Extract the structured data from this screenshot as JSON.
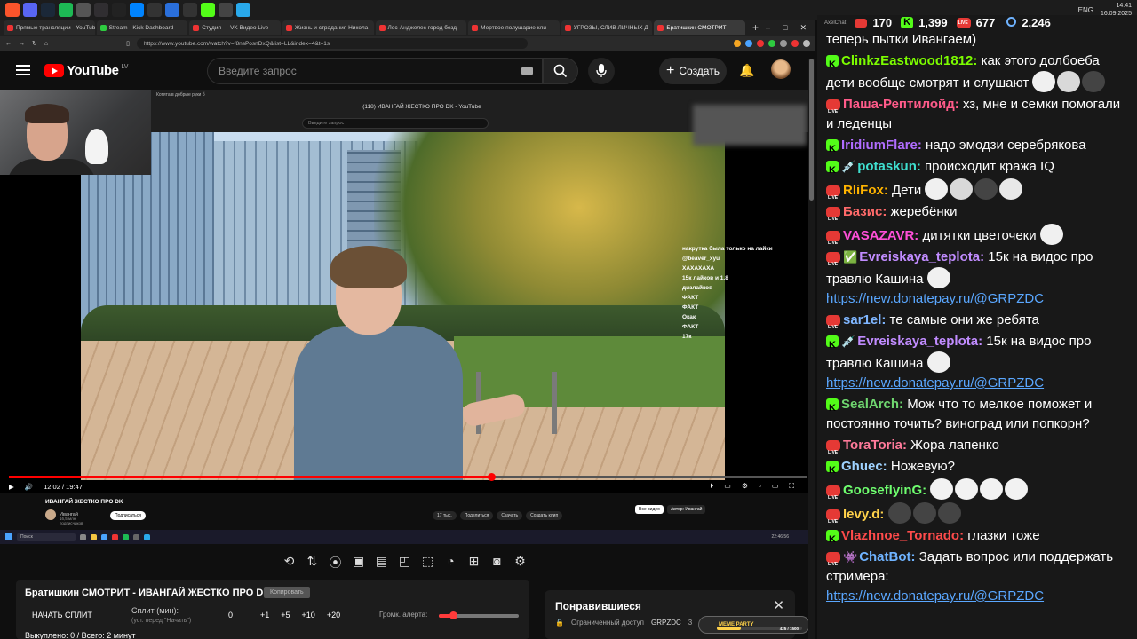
{
  "taskbar": {
    "clock_time": "14:41",
    "clock_date": "16.09.2025",
    "lang": "ENG",
    "icons": [
      {
        "name": "brave-icon",
        "color": "#fb542b"
      },
      {
        "name": "discord-icon",
        "color": "#5865f2"
      },
      {
        "name": "steam-icon",
        "color": "#1b2838"
      },
      {
        "name": "spotify-icon",
        "color": "#1db954"
      },
      {
        "name": "app-icon",
        "color": "#555555"
      },
      {
        "name": "obs-icon",
        "color": "#302e31"
      },
      {
        "name": "capcut-icon",
        "color": "#222222"
      },
      {
        "name": "messenger-icon",
        "color": "#0084ff"
      },
      {
        "name": "app2-icon",
        "color": "#333333"
      },
      {
        "name": "app3-icon",
        "color": "#2a6fdb"
      },
      {
        "name": "app4-icon",
        "color": "#333333"
      },
      {
        "name": "kick-icon",
        "color": "#53fc18"
      },
      {
        "name": "app5-icon",
        "color": "#444444"
      },
      {
        "name": "telegram-icon",
        "color": "#29a9eb"
      }
    ]
  },
  "browser": {
    "tabs": [
      {
        "label": "Прямые трансляции - YouTub",
        "fav": "red"
      },
      {
        "label": "Stream - Kick Dashboard",
        "fav": "green"
      },
      {
        "label": "Студия — VK Видео Live",
        "fav": "red"
      },
      {
        "label": "Жизнь и страдания Никола",
        "fav": "red"
      },
      {
        "label": "Лос-Анджелес город безд",
        "fav": "red"
      },
      {
        "label": "Мертвое полушарие кли",
        "fav": "red"
      },
      {
        "label": "УГРОЗЫ, СЛИВ ЛИЧНЫХ Д",
        "fav": "red"
      },
      {
        "label": "Братишкин СМОТРИТ -",
        "fav": "red",
        "active": true
      }
    ],
    "new_tab": "+",
    "url": "https://www.youtube.com/watch?v=f8nsPosnDxQ&list=LL&index=4&t=1s"
  },
  "youtube": {
    "logo_text": "YouTube",
    "logo_region": "LV",
    "search_placeholder": "Введите запрос",
    "create_label": "Создать"
  },
  "video": {
    "inner_window_title": "(118) ИВАНГАЙ ЖЕСТКО ПРО DK - YouTube",
    "inner_tab_label": "Котята в добрые руки б",
    "inner_search_placeholder": "Введите запрос",
    "time_current": "12:02",
    "time_total": "19:47",
    "progress_fraction": 0.605,
    "stream_chat": [
      "накрутка была только на лайки",
      "@beaver_xyu",
      "ХАХАХАХА",
      "15к лайков и 1.8",
      "дизлайков",
      "ФАКТ",
      "ФАКТ",
      "Окак",
      "ФАКТ",
      "17к"
    ],
    "inner_video_title": "ИВАНГАЙ ЖЕСТКО ПРО DK",
    "inner_channel": "Ивангай",
    "inner_subs": "16,5 млн подписчиков",
    "inner_subscribe": "Подписаться",
    "inner_actions": [
      "17 тыс.",
      "Поделиться",
      "Скачать",
      "Создать клип"
    ],
    "inner_tabs": [
      "Все видео",
      "Автор: Ивангай"
    ],
    "inner_taskbar_search": "Поиск",
    "inner_clock": "22:46:56"
  },
  "split_panel": {
    "title": "Братишкин СМОТРИТ - ИВАНГАЙ ЖЕСТКО ПРО DK",
    "copy_button": "Копировать",
    "start_button": "НАЧАТЬ СПЛИТ",
    "split_label": "Сплит (мин):",
    "split_hint": "(уст. перед \"Начать\")",
    "split_value": "0",
    "increments": [
      "+1",
      "+5",
      "+10",
      "+20"
    ],
    "volume_label": "Громк. алерта:",
    "volume_fraction": 0.18,
    "bought_text": "Выкуплено: 0 / Всего: 2 минут"
  },
  "liked_panel": {
    "title": "Понравившиеся",
    "access": "Ограниченный доступ",
    "owner": "GRPZDC",
    "count_prefix": "3"
  },
  "meme_party": {
    "label": "MEME PARTY",
    "counter": "425 / 1500",
    "progress_fraction": 0.28
  },
  "chat": {
    "brand": "AxelChat",
    "stats": {
      "youtube": "170",
      "kick": "1,399",
      "vk": "677",
      "viewers": "2,246"
    },
    "messages": [
      {
        "platform": "none",
        "nick": "",
        "text": "теперь пытки Ивангаем)",
        "nick_color": "#ffffff"
      },
      {
        "platform": "kick",
        "nick": "ClinkzEastwood1812:",
        "nick_color": "#7cfc00",
        "text": "как этого долбоеба дети вообще смотрят и слушают",
        "emotes": 3
      },
      {
        "platform": "live",
        "nick": "Паша-Рептилойд:",
        "nick_color": "#ff5b8a",
        "text": "хз, мне и семки помогали и леденцы"
      },
      {
        "platform": "kick",
        "nick": "IridiumFlare:",
        "nick_color": "#b06cff",
        "text": "надо эмодзи серебрякова"
      },
      {
        "platform": "kick",
        "badge": "💉",
        "nick": "potaskun:",
        "nick_color": "#3fe0d0",
        "text": "происходит кража IQ"
      },
      {
        "platform": "live",
        "nick": "RliFox:",
        "nick_color": "#ffb400",
        "text": "Дети",
        "emotes": 4
      },
      {
        "platform": "live",
        "nick": "Базис:",
        "nick_color": "#ff6a6a",
        "text": "жеребёнки"
      },
      {
        "platform": "live",
        "nick": "VASAZAVR:",
        "nick_color": "#ff4fd8",
        "text": "дитятки цветочеки",
        "emotes": 1
      },
      {
        "platform": "live",
        "badge": "✅",
        "nick": "Evreiskaya_teplota:",
        "nick_color": "#c18cff",
        "text": "15к на видос про травлю Кашина",
        "emotes": 1,
        "link": "https://new.donatepay.ru/@GRPZDC"
      },
      {
        "platform": "live",
        "nick": "sar1el:",
        "nick_color": "#7fb6ff",
        "text": "те самые они же ребята"
      },
      {
        "platform": "kick",
        "badge": "💉",
        "nick": "Evreiskaya_teplota:",
        "nick_color": "#c18cff",
        "text": "15к на видос про травлю Кашина",
        "emotes": 1,
        "link": "https://new.donatepay.ru/@GRPZDC"
      },
      {
        "platform": "kick",
        "nick": "SealArch:",
        "nick_color": "#6fd66f",
        "text": "Мож что то мелкое поможет и постоянно точить? виноград или попкорн?"
      },
      {
        "platform": "live",
        "nick": "ToraToria:",
        "nick_color": "#ff7a9a",
        "text": "Жора лапенко"
      },
      {
        "platform": "kick",
        "nick": "Ghuec:",
        "nick_color": "#9fd2ff",
        "text": "Ножевую?"
      },
      {
        "platform": "live",
        "nick": "GooseflyinG:",
        "nick_color": "#6fff6f",
        "text": "",
        "emotes": 4
      },
      {
        "platform": "live",
        "nick": "levy.d:",
        "nick_color": "#ffd24a",
        "text": "",
        "emotes": 3
      },
      {
        "platform": "kick",
        "nick": "Vlazhnoe_Tornado:",
        "nick_color": "#ff4b4b",
        "text": "глазки тоже"
      },
      {
        "platform": "live",
        "badge": "👾",
        "nick": "ChatBot:",
        "nick_color": "#6fb3ff",
        "text": "Задать вопрос или поддержать стримера:",
        "link": "https://new.donatepay.ru/@GRPZDC"
      }
    ]
  }
}
